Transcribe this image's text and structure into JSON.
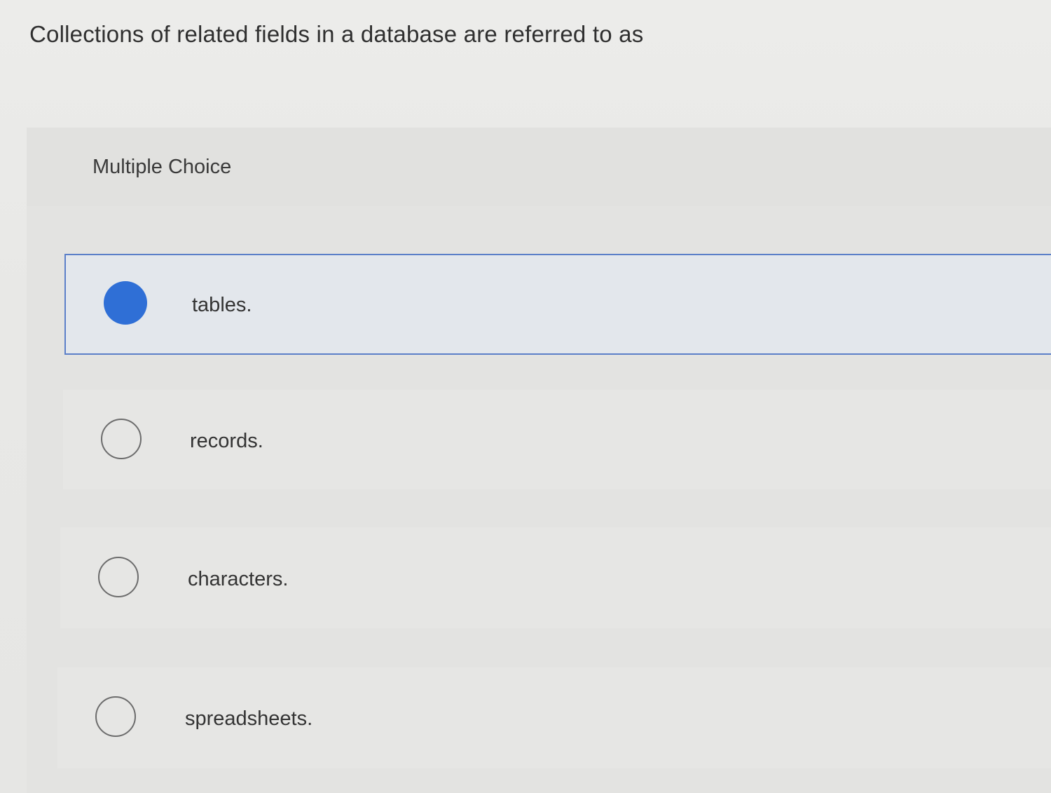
{
  "question": {
    "text": "Collections of related fields in a database are referred to as"
  },
  "multiple_choice": {
    "label": "Multiple Choice",
    "options": [
      {
        "label": "tables.",
        "selected": true
      },
      {
        "label": "records.",
        "selected": false
      },
      {
        "label": "characters.",
        "selected": false
      },
      {
        "label": "spreadsheets.",
        "selected": false
      }
    ]
  },
  "colors": {
    "selected_radio": "#2f6fd6",
    "selected_border": "#5b7fc8",
    "background": "#e9e9e7"
  }
}
